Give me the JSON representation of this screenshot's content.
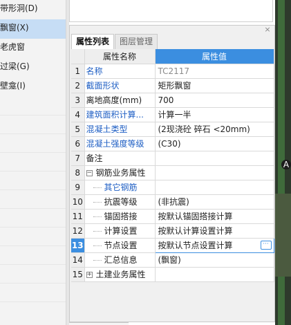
{
  "left_menu": {
    "items": [
      {
        "label": "带形洞(D)",
        "selected": false
      },
      {
        "label": "飘窗(X)",
        "selected": true
      },
      {
        "label": "老虎窗",
        "selected": false
      },
      {
        "label": "过梁(G)",
        "selected": false
      },
      {
        "label": "壁龛(I)",
        "selected": false
      }
    ]
  },
  "panel": {
    "close_glyph": "×",
    "tabs": [
      {
        "label": "属性列表",
        "active": true
      },
      {
        "label": "图层管理",
        "active": false
      }
    ],
    "header": {
      "name": "属性名称",
      "value": "属性值"
    },
    "rows": [
      {
        "num": "1",
        "name": "名称",
        "value": "TC2117",
        "name_style": "blue",
        "value_style": "gray",
        "indent": false
      },
      {
        "num": "2",
        "name": "截面形状",
        "value": "矩形飘窗",
        "name_style": "blue",
        "value_style": "",
        "indent": false
      },
      {
        "num": "3",
        "name": "离地高度(mm)",
        "value": "700",
        "name_style": "",
        "value_style": "",
        "indent": false
      },
      {
        "num": "4",
        "name": "建筑面积计算...",
        "value": "计算一半",
        "name_style": "blue",
        "value_style": "",
        "indent": false
      },
      {
        "num": "5",
        "name": "混凝土类型",
        "value": "(2现浇砼 碎石 <20mm)",
        "name_style": "blue",
        "value_style": "",
        "indent": false
      },
      {
        "num": "6",
        "name": "混凝土强度等级",
        "value": "(C30)",
        "name_style": "blue",
        "value_style": "",
        "indent": false
      },
      {
        "num": "7",
        "name": "备注",
        "value": "",
        "name_style": "",
        "value_style": "",
        "indent": false
      },
      {
        "num": "8",
        "name": "钢筋业务属性",
        "value": "",
        "name_style": "",
        "value_style": "",
        "indent": false,
        "toggle": "−"
      },
      {
        "num": "9",
        "name": "其它钢筋",
        "value": "",
        "name_style": "blue",
        "value_style": "",
        "indent": true
      },
      {
        "num": "10",
        "name": "抗震等级",
        "value": "(非抗震)",
        "name_style": "",
        "value_style": "",
        "indent": true
      },
      {
        "num": "11",
        "name": "锚固搭接",
        "value": "按默认锚固搭接计算",
        "name_style": "",
        "value_style": "",
        "indent": true
      },
      {
        "num": "12",
        "name": "计算设置",
        "value": "按默认计算设置计算",
        "name_style": "",
        "value_style": "",
        "indent": true
      },
      {
        "num": "13",
        "name": "节点设置",
        "value": "按默认节点设置计算",
        "name_style": "",
        "value_style": "",
        "indent": true,
        "current": true,
        "button": "···"
      },
      {
        "num": "14",
        "name": "汇总信息",
        "value": "(飘窗)",
        "name_style": "",
        "value_style": "",
        "indent": true
      },
      {
        "num": "15",
        "name": "土建业务属性",
        "value": "",
        "name_style": "",
        "value_style": "",
        "indent": false,
        "toggle": "+"
      }
    ]
  },
  "viewport": {
    "marker": "A"
  }
}
